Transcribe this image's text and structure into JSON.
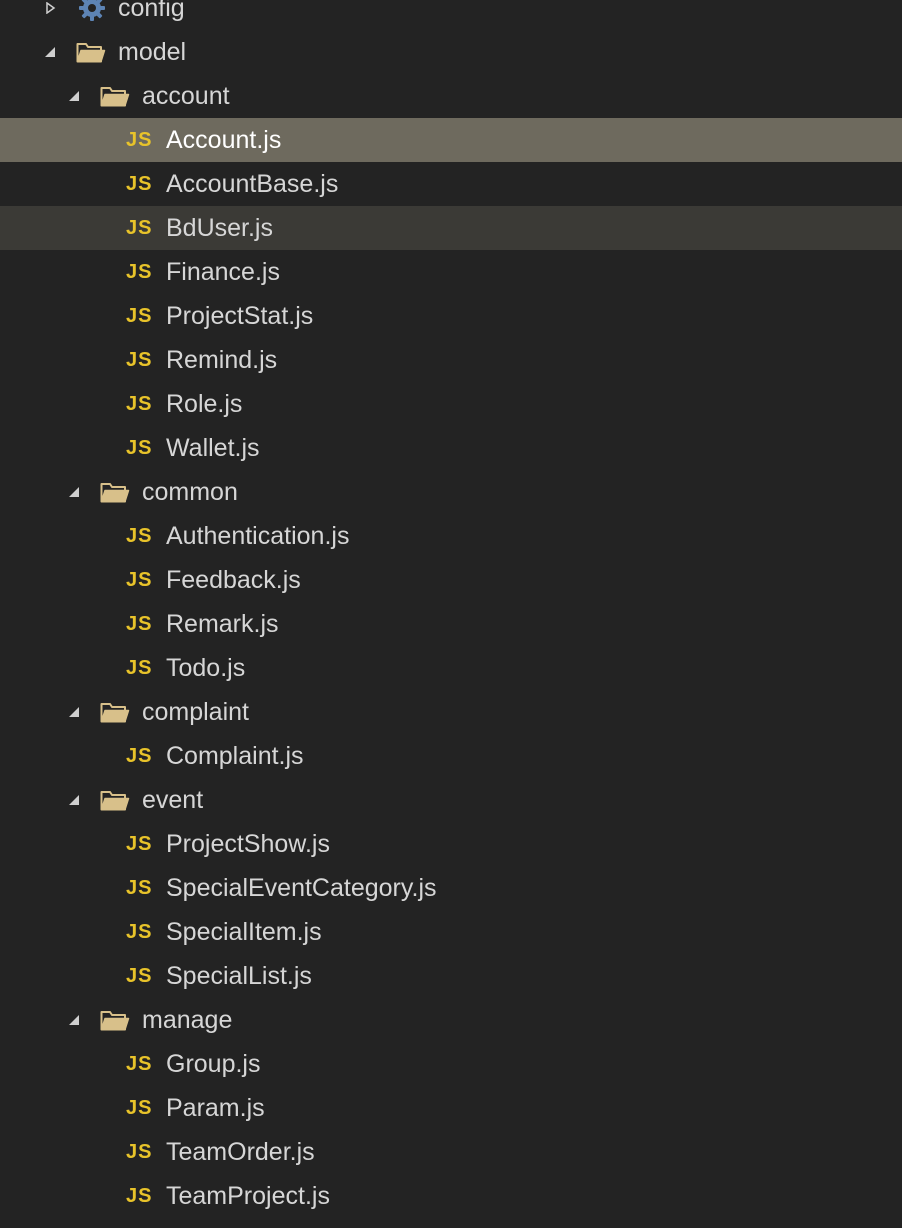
{
  "tree": {
    "config": {
      "label": "config",
      "expanded": false,
      "icon": "gear-icon"
    },
    "model": {
      "label": "model",
      "expanded": true,
      "folders": [
        {
          "label": "account",
          "expanded": true,
          "files": [
            "Account.js",
            "AccountBase.js",
            "BdUser.js",
            "Finance.js",
            "ProjectStat.js",
            "Remind.js",
            "Role.js",
            "Wallet.js"
          ]
        },
        {
          "label": "common",
          "expanded": true,
          "files": [
            "Authentication.js",
            "Feedback.js",
            "Remark.js",
            "Todo.js"
          ]
        },
        {
          "label": "complaint",
          "expanded": true,
          "files": [
            "Complaint.js"
          ]
        },
        {
          "label": "event",
          "expanded": true,
          "files": [
            "ProjectShow.js",
            "SpecialEventCategory.js",
            "SpecialItem.js",
            "SpecialList.js"
          ]
        },
        {
          "label": "manage",
          "expanded": true,
          "files": [
            "Group.js",
            "Param.js",
            "TeamOrder.js",
            "TeamProject.js"
          ]
        }
      ]
    },
    "trailing_folder": {
      "label": "",
      "expanded": true
    }
  },
  "file_icon_text": "JS",
  "selected_file": "Account.js",
  "hovered_file": "BdUser.js",
  "colors": {
    "background": "#232323",
    "selected_row": "#6e6a5e",
    "hover_row": "#3b3a36",
    "text": "#d6d6d6",
    "js_icon": "#e8c32a",
    "folder_icon": "#d8c08a",
    "twisty": "#cfcfcf"
  }
}
